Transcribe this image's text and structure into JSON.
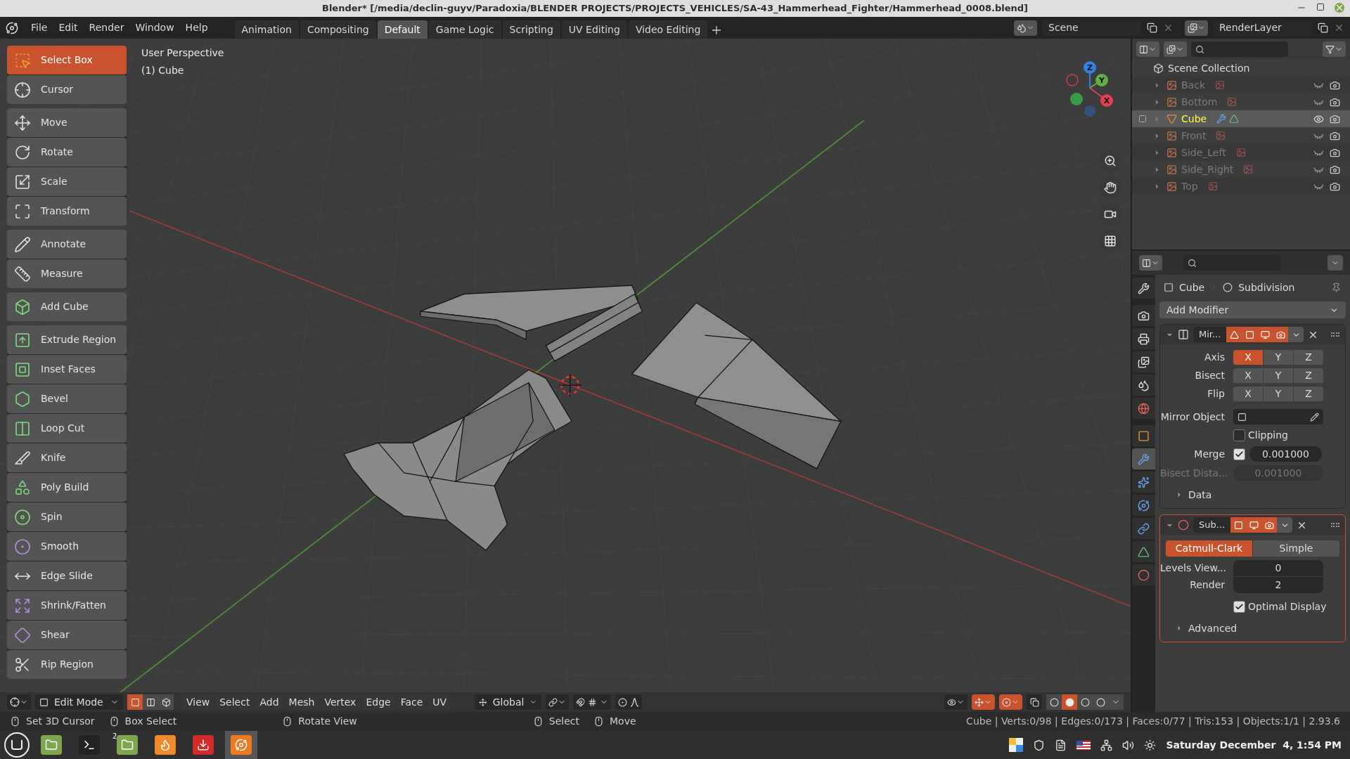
{
  "window": {
    "title": "Blender* [/media/declin-guyv/Paradoxia/BLENDER PROJECTS/PROJECTS_VEHICLES/SA-43_Hammerhead_Fighter/Hammerhead_0008.blend]"
  },
  "menu": [
    "File",
    "Edit",
    "Render",
    "Window",
    "Help"
  ],
  "workspaces": [
    {
      "label": "Animation",
      "selected": false
    },
    {
      "label": "Compositing",
      "selected": false
    },
    {
      "label": "Default",
      "selected": true
    },
    {
      "label": "Game Logic",
      "selected": false
    },
    {
      "label": "Scripting",
      "selected": false
    },
    {
      "label": "UV Editing",
      "selected": false
    },
    {
      "label": "Video Editing",
      "selected": false
    }
  ],
  "scene": {
    "label": "Scene"
  },
  "view_layer": {
    "label": "RenderLayer"
  },
  "toolbar": {
    "groups": [
      {
        "tools": [
          {
            "label": "Select Box",
            "selected": true
          },
          {
            "label": "Cursor",
            "selected": false
          }
        ]
      },
      {
        "tools": [
          {
            "label": "Move",
            "selected": false
          },
          {
            "label": "Rotate",
            "selected": false
          },
          {
            "label": "Scale",
            "selected": false
          },
          {
            "label": "Transform",
            "selected": false
          }
        ]
      },
      {
        "tools": [
          {
            "label": "Annotate",
            "selected": false
          },
          {
            "label": "Measure",
            "selected": false
          }
        ]
      },
      {
        "tools": [
          {
            "label": "Add Cube",
            "selected": false
          }
        ]
      },
      {
        "tools": [
          {
            "label": "Extrude Region",
            "selected": false
          },
          {
            "label": "Inset Faces",
            "selected": false
          },
          {
            "label": "Bevel",
            "selected": false
          },
          {
            "label": "Loop Cut",
            "selected": false
          },
          {
            "label": "Knife",
            "selected": false
          },
          {
            "label": "Poly Build",
            "selected": false
          },
          {
            "label": "Spin",
            "selected": false
          },
          {
            "label": "Smooth",
            "selected": false
          },
          {
            "label": "Edge Slide",
            "selected": false
          },
          {
            "label": "Shrink/Fatten",
            "selected": false
          },
          {
            "label": "Shear",
            "selected": false
          },
          {
            "label": "Rip Region",
            "selected": false
          }
        ]
      }
    ]
  },
  "viewport": {
    "perspective": "User Perspective",
    "object": "(1) Cube",
    "gizmo": [
      "X",
      "Y",
      "Z"
    ]
  },
  "viewport_header": {
    "mode": "Edit Mode",
    "select_modes": [
      {
        "selected": true
      },
      {
        "selected": false
      },
      {
        "selected": false
      }
    ],
    "menus": [
      "View",
      "Select",
      "Add",
      "Mesh",
      "Vertex",
      "Edge",
      "Face",
      "UV"
    ],
    "orientation": "Global",
    "shading": [
      {
        "selected": false
      },
      {
        "selected": true
      },
      {
        "selected": false
      },
      {
        "selected": false
      }
    ]
  },
  "outliner": {
    "root": "Scene Collection",
    "items": [
      {
        "label": "Back",
        "kind": "image",
        "selected": false,
        "visible": false
      },
      {
        "label": "Bottom",
        "kind": "image",
        "selected": false,
        "visible": false
      },
      {
        "label": "Cube",
        "kind": "mesh",
        "selected": true,
        "visible": true
      },
      {
        "label": "Front",
        "kind": "image",
        "selected": false,
        "visible": false
      },
      {
        "label": "Side_Left",
        "kind": "image",
        "selected": false,
        "visible": false
      },
      {
        "label": "Side_Right",
        "kind": "image",
        "selected": false,
        "visible": false
      },
      {
        "label": "Top",
        "kind": "image",
        "selected": false,
        "visible": false
      }
    ]
  },
  "properties": {
    "tabs": [
      {
        "selected": false
      },
      {
        "selected": false
      },
      {
        "selected": false
      },
      {
        "selected": false
      },
      {
        "selected": false
      },
      {
        "selected": false
      },
      {
        "selected": false
      },
      {
        "selected": true
      },
      {
        "selected": false
      },
      {
        "selected": false
      },
      {
        "selected": false
      },
      {
        "selected": false
      },
      {
        "selected": false
      }
    ],
    "breadcrumb": [
      "Cube",
      "Subdivision"
    ],
    "add_modifier": "Add Modifier",
    "modifiers": [
      {
        "kind": "mirror",
        "name": "Mir...",
        "active": false,
        "toggles": [
          {
            "on": true
          },
          {
            "on": true
          },
          {
            "on": true
          },
          {
            "on": true
          }
        ],
        "axes": [
          {
            "label": "Axis",
            "buttons": [
              {
                "label": "X",
                "selected": true
              },
              {
                "label": "Y",
                "selected": false
              },
              {
                "label": "Z",
                "selected": false
              }
            ]
          },
          {
            "label": "Bisect",
            "buttons": [
              {
                "label": "X",
                "selected": false
              },
              {
                "label": "Y",
                "selected": false
              },
              {
                "label": "Z",
                "selected": false
              }
            ]
          },
          {
            "label": "Flip",
            "buttons": [
              {
                "label": "X",
                "selected": false
              },
              {
                "label": "Y",
                "selected": false
              },
              {
                "label": "Z",
                "selected": false
              }
            ]
          }
        ],
        "mirror_object": "Mirror Object",
        "clipping": {
          "label": "Clipping",
          "checked": false
        },
        "merge": {
          "label": "Merge",
          "checked": true,
          "value": "0.001000"
        },
        "bisect_distance": {
          "label": "Bisect Dista...",
          "value": "0.001000",
          "disabled": true
        },
        "data": {
          "label": "Data",
          "expanded": false
        }
      },
      {
        "kind": "subdivision",
        "name": "Sub...",
        "active": true,
        "toggles": [
          {
            "on": true
          },
          {
            "on": true
          },
          {
            "on": true
          }
        ],
        "methods": [
          {
            "label": "Catmull-Clark",
            "selected": true
          },
          {
            "label": "Simple",
            "selected": false
          }
        ],
        "levels": [
          {
            "label": "Levels View...",
            "value": "0"
          },
          {
            "label": "Render",
            "value": "2"
          }
        ],
        "optimal_display": {
          "label": "Optimal Display",
          "checked": true
        },
        "advanced": {
          "label": "Advanced",
          "expanded": false
        }
      }
    ]
  },
  "status_bar": {
    "hints": [
      "Set 3D Cursor",
      "Box Select",
      "Rotate View",
      "Select",
      "Move"
    ],
    "stats": "Cube | Verts:0/98 | Edges:0/173 | Faces:0/77 | Tris:153 | Objects:1/1 | 2.93.6"
  },
  "taskbar": {
    "apps": [
      {
        "selected": false
      },
      {
        "selected": false
      },
      {
        "selected": false
      },
      {
        "selected": false
      },
      {
        "selected": false
      },
      {
        "selected": true
      }
    ],
    "badge": "2",
    "clock": "Saturday December  4, 1:54 PM"
  }
}
